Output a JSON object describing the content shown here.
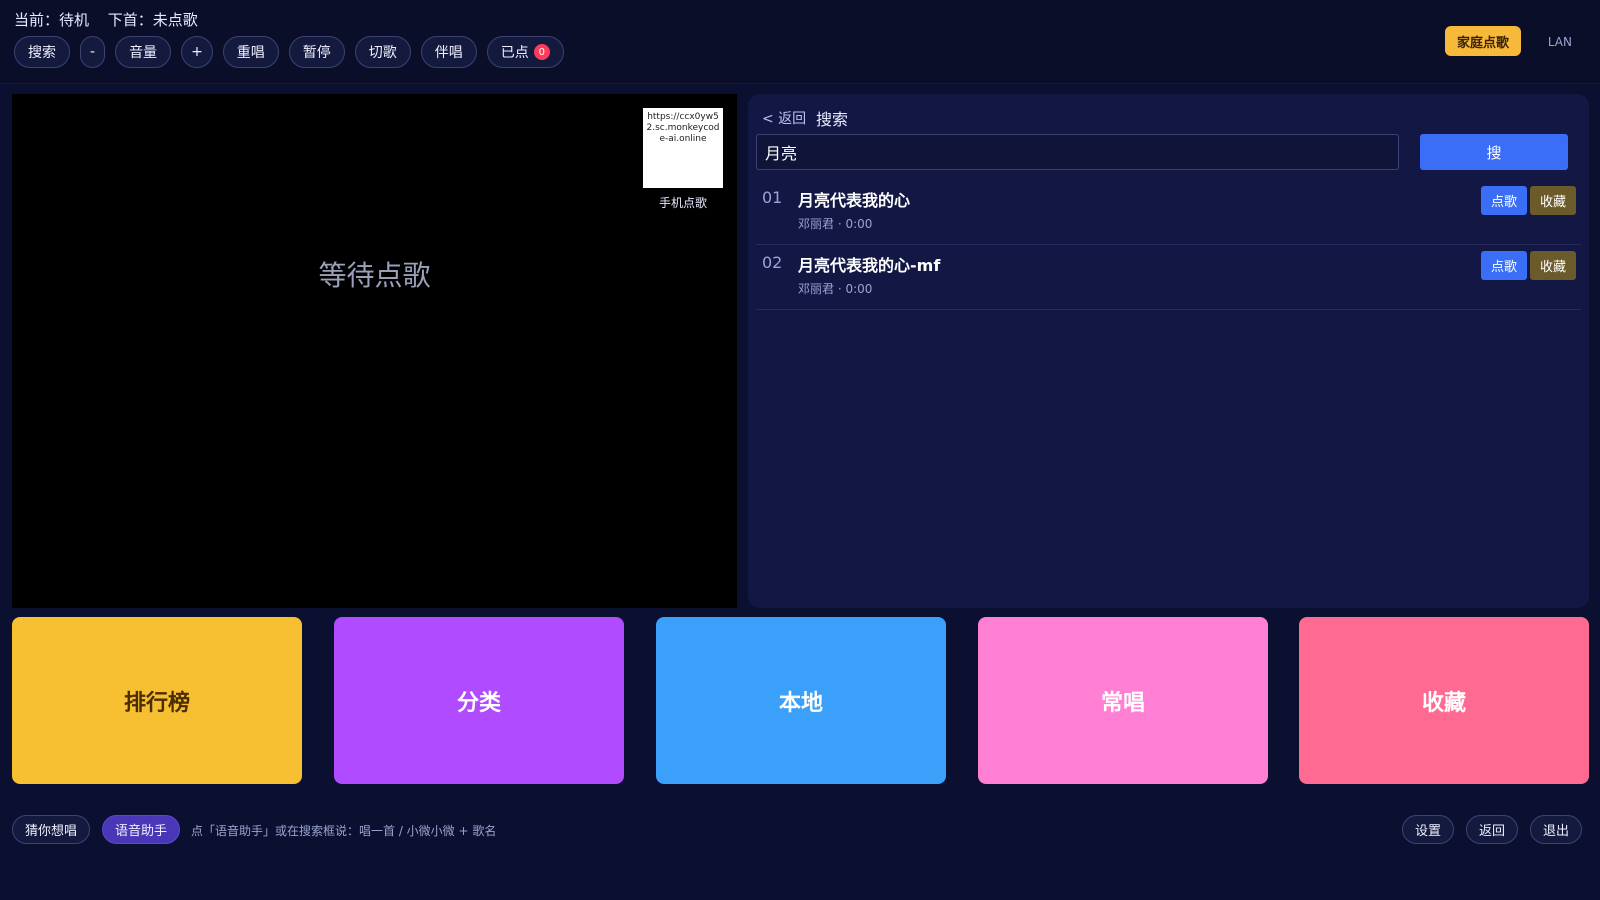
{
  "status": {
    "current": "当前：待机",
    "next": "下首：未点歌"
  },
  "toolbar": {
    "search": "搜索",
    "vol_down": "-",
    "volume": "音量",
    "vol_up": "+",
    "replay": "重唱",
    "pause": "暂停",
    "skip": "切歌",
    "accompany": "伴唱",
    "queued": "已点",
    "queued_count": "0"
  },
  "header": {
    "family_button": "家庭点歌",
    "network": "LAN"
  },
  "video": {
    "waiting_text": "等待点歌",
    "qr_text": "https://ccx0yw52.sc.monkeycode-ai.online",
    "qr_label": "手机点歌"
  },
  "search_panel": {
    "back": "< 返回",
    "title": "搜索",
    "query": "月亮",
    "search_button": "搜",
    "results": [
      {
        "index": "01",
        "title": "月亮代表我的心",
        "meta": "邓丽君 · 0:00",
        "order": "点歌",
        "favorite": "收藏"
      },
      {
        "index": "02",
        "title": "月亮代表我的心-mf",
        "meta": "邓丽君 · 0:00",
        "order": "点歌",
        "favorite": "收藏"
      }
    ]
  },
  "tiles": [
    {
      "label": "排行榜",
      "color": "#f7bf32",
      "text_color": "#4a2e00"
    },
    {
      "label": "分类",
      "color": "#b04bff",
      "text_color": "#ffffff"
    },
    {
      "label": "本地",
      "color": "#3aa0fa",
      "text_color": "#ffffff"
    },
    {
      "label": "常唱",
      "color": "#ff7fd5",
      "text_color": "#ffffff"
    },
    {
      "label": "收藏",
      "color": "#ff6a93",
      "text_color": "#ffffff"
    }
  ],
  "bottombar": {
    "guess": "猜你想唱",
    "voice": "语音助手",
    "hint": "点「语音助手」或在搜索框说：唱一首 / 小微小微 + 歌名",
    "settings": "设置",
    "back": "返回",
    "exit": "退出"
  }
}
